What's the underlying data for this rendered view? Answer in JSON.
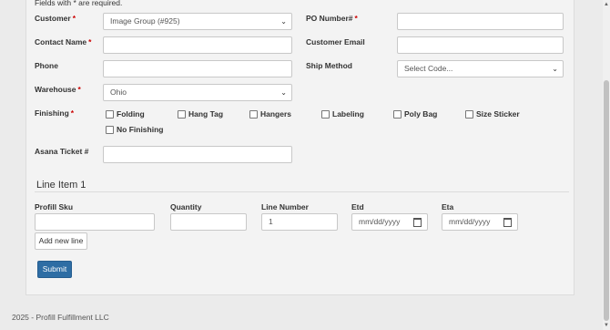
{
  "form": {
    "required_note": "Fields with * are required.",
    "req_mark": "*",
    "customer": {
      "label": "Customer",
      "value": "Image Group (#925)"
    },
    "po_number": {
      "label": "PO Number#",
      "value": ""
    },
    "contact_name": {
      "label": "Contact Name",
      "value": ""
    },
    "customer_email": {
      "label": "Customer Email",
      "value": ""
    },
    "phone": {
      "label": "Phone",
      "value": ""
    },
    "ship_method": {
      "label": "Ship Method",
      "value": "Select Code..."
    },
    "warehouse": {
      "label": "Warehouse",
      "value": "Ohio"
    },
    "finishing": {
      "label": "Finishing",
      "options": [
        "Folding",
        "Hang Tag",
        "Hangers",
        "Labeling",
        "Poly Bag",
        "Size Sticker",
        "No Finishing"
      ]
    },
    "asana_ticket": {
      "label": "Asana Ticket #",
      "value": ""
    }
  },
  "line_item": {
    "title": "Line Item 1",
    "profill_sku": {
      "label": "Profill Sku",
      "value": ""
    },
    "quantity": {
      "label": "Quantity",
      "value": ""
    },
    "line_number": {
      "label": "Line Number",
      "value": "1"
    },
    "etd": {
      "label": "Etd",
      "placeholder": "mm/dd/yyyy"
    },
    "eta": {
      "label": "Eta",
      "placeholder": "mm/dd/yyyy"
    }
  },
  "buttons": {
    "add_line": "Add new line",
    "submit": "Submit"
  },
  "footer": {
    "text": "2025 - Profill Fulfillment LLC"
  },
  "icons": {
    "select_arrow": "chevron-down-icon",
    "calendar": "calendar-icon"
  }
}
